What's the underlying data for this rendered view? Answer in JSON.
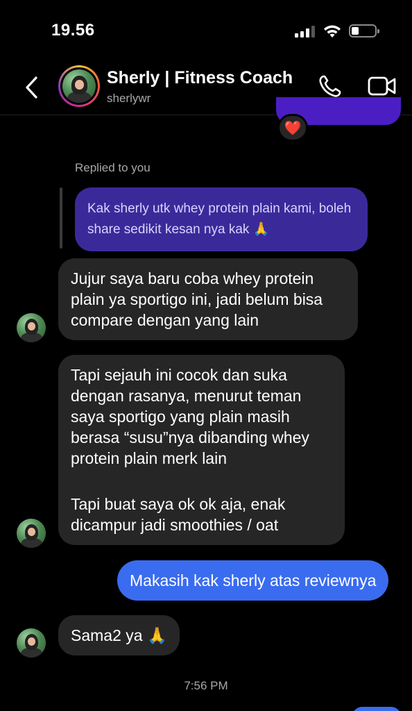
{
  "status_bar": {
    "time": "19.56"
  },
  "header": {
    "contact_name": "Sherly | Fitness Coach",
    "username": "sherlywr",
    "icons": [
      "back-chevron-icon",
      "phone-icon",
      "video-camera-icon"
    ]
  },
  "thread": {
    "reaction": "❤️",
    "replied_label": "Replied to you",
    "reply_quote": "Kak sherly utk whey protein plain kami, boleh share sedikit kesan nya kak 🙏",
    "msg1": "Jujur saya baru coba whey protein plain ya sportigo ini, jadi belum bisa compare dengan yang lain",
    "msg2_p1": "Tapi sejauh ini cocok dan suka dengan rasanya, menurut teman saya sportigo yang plain masih berasa “susu”nya dibanding whey protein plain merk lain",
    "msg2_p2": "Tapi buat saya ok ok aja, enak dicampur jadi smoothies / oat",
    "msg3_out": "Makasih kak sherly atas reviewnya",
    "msg4": "Sama2 ya 🙏",
    "timestamp": "7:56 PM"
  },
  "colors": {
    "background": "#000000",
    "incoming_bubble": "#262626",
    "outgoing_bubble": "#3a6cf0",
    "reply_bubble": "#3a2a99",
    "secondary_text": "#a8a8a8"
  }
}
